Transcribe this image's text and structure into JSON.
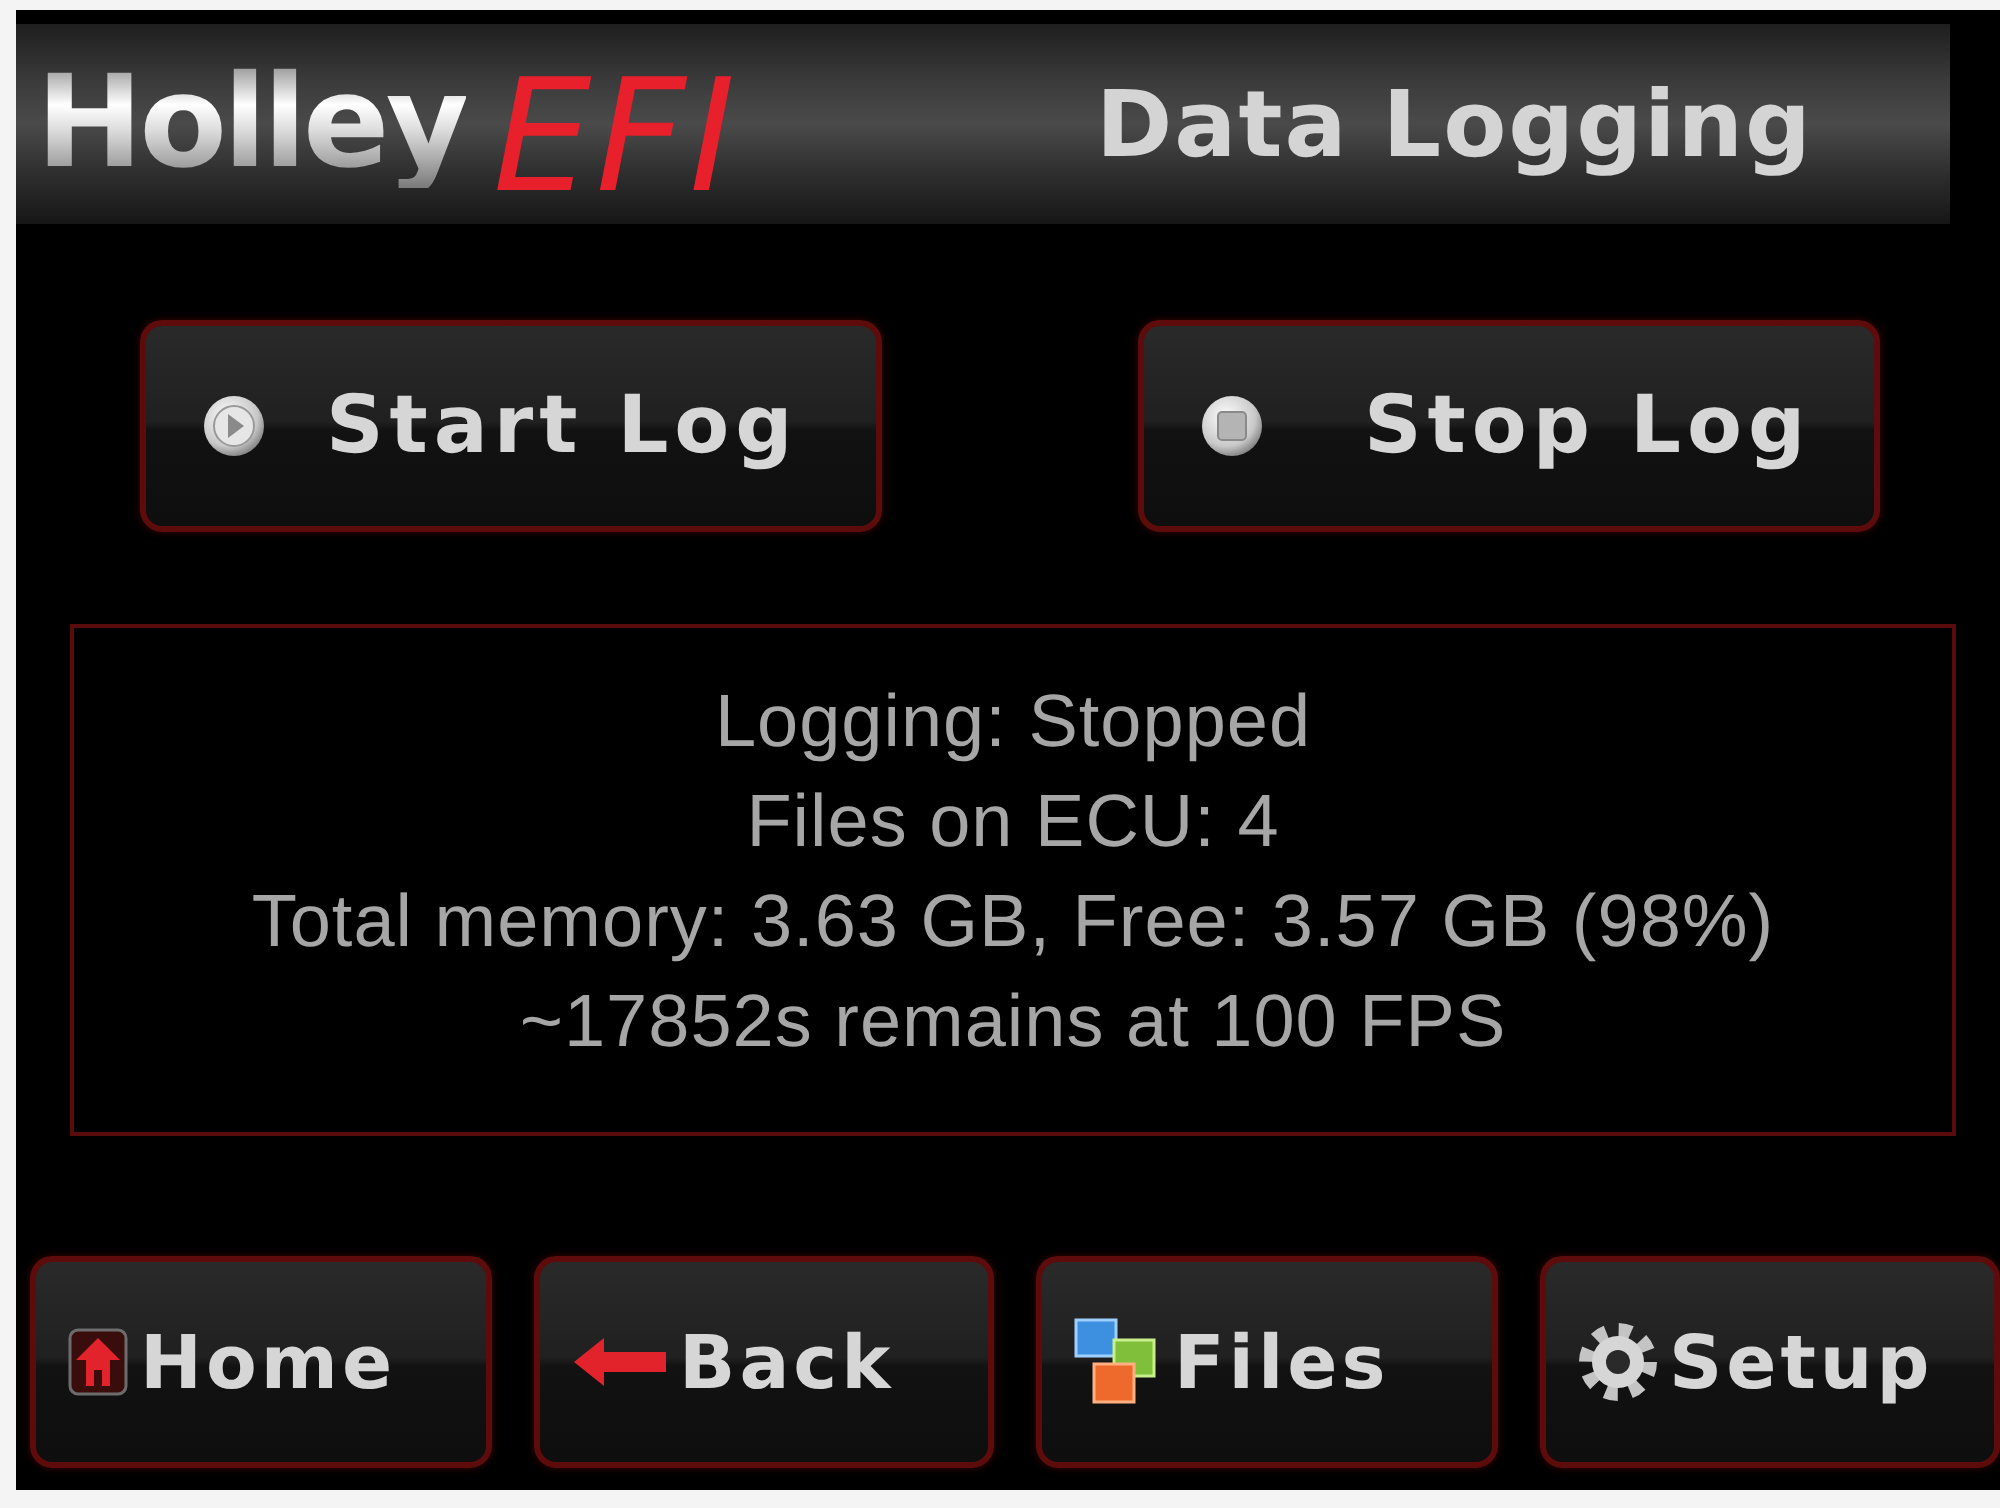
{
  "header": {
    "logo": {
      "brand": "Holley",
      "product": "EFI"
    },
    "title": "Data Logging"
  },
  "log_controls": [
    {
      "kind": "start",
      "label": "Start Log"
    },
    {
      "kind": "stop",
      "label": "Stop Log"
    }
  ],
  "status_panel": {
    "lines": [
      "Logging: Stopped",
      "Files on ECU: 4",
      "Total memory: 3.63 GB, Free: 3.57 GB (98%)",
      "~17852s remains at 100 FPS"
    ]
  },
  "nav_buttons": [
    {
      "kind": "home",
      "label": "Home"
    },
    {
      "kind": "back",
      "label": "Back"
    },
    {
      "kind": "files",
      "label": "Files"
    },
    {
      "kind": "setup",
      "label": "Setup"
    }
  ]
}
